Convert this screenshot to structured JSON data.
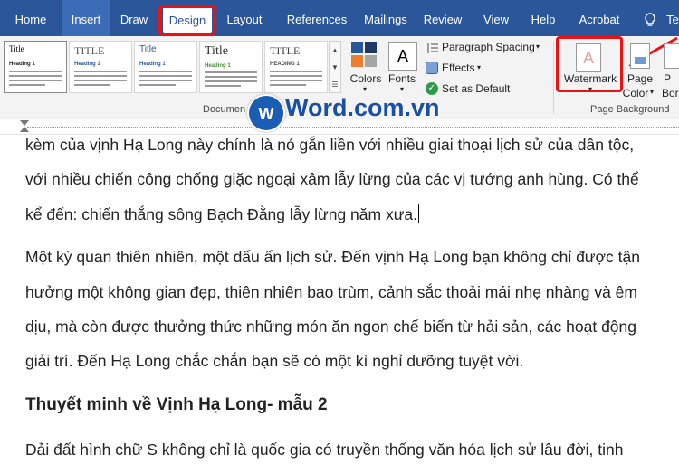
{
  "tabs": [
    "Home",
    "Insert",
    "Draw",
    "Design",
    "Layout",
    "References",
    "Mailings",
    "Review",
    "View",
    "Help",
    "Acrobat"
  ],
  "tell_me_partial": "Te",
  "gallery": {
    "styles": [
      {
        "title": "Title",
        "heading": "Heading 1"
      },
      {
        "title": "TITLE",
        "heading": "Heading 1"
      },
      {
        "title": "Title",
        "heading": "Heading 1"
      },
      {
        "title": "Title",
        "heading": "Heading 1"
      },
      {
        "title": "TITLE",
        "heading": "HEADING 1"
      }
    ],
    "group_label_partial": "Documen"
  },
  "formatting": {
    "colors_label": "Colors",
    "fonts_label": "Fonts",
    "paragraph_spacing_label": "Paragraph Spacing",
    "effects_label": "Effects",
    "set_default_label": "Set as Default"
  },
  "page_background": {
    "watermark_label": "Watermark",
    "page_color_label_1": "Page",
    "page_color_label_2": "Color",
    "page_borders_label_1": "P",
    "page_borders_label_2": "Bor",
    "group_label": "Page Background"
  },
  "logo": {
    "text": "Word.com.vn"
  },
  "document": {
    "lines": [
      "kèm của vịnh Hạ Long này chính là nó gắn liền với nhiều giai thoại lịch sử của dân tộc,",
      "với nhiều chiến công chống giặc ngoại xâm lẫy lừng của các vị tướng anh hùng. Có thể",
      "kể đến: chiến thắng sông Bạch Đằng lẫy lừng năm xưa.",
      "Một kỳ quan thiên nhiên, một dấu ấn lịch sử. Đến vịnh Hạ Long bạn không chỉ được tận",
      "hưởng một không gian đẹp, thiên nhiên bao trùm, cảnh sắc thoải mái nhẹ nhàng và êm",
      "dịu, mà còn được thưởng thức những món ăn ngon chế biến từ hải sản, các hoạt động",
      "giải trí. Đến Hạ Long chắc chắn bạn sẽ có một kì nghỉ dưỡng tuyệt vời."
    ],
    "heading": "Thuyết minh về Vịnh Hạ Long- mẫu 2",
    "last_line": "Dải đất hình chữ S không chỉ là quốc gia có truyền thống văn hóa lịch sử lâu đời, tinh"
  },
  "colors": {
    "ribbon_blue": "#2b579a",
    "highlight_red": "#e11111",
    "logo_blue": "#1a5db5"
  }
}
